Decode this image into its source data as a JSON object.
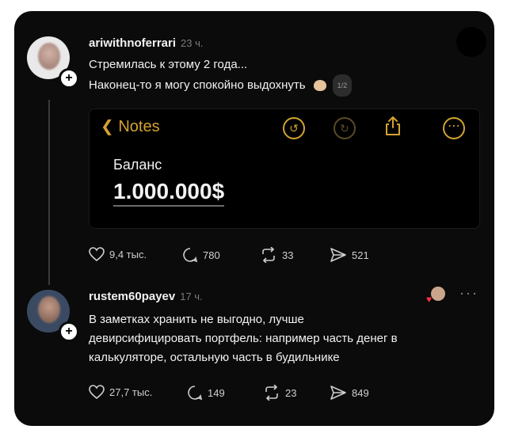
{
  "post": {
    "username": "ariwithnoferrari",
    "time": "23 ч.",
    "line1": "Стремилась к этому 2 года...",
    "line2": "Наконец-то я могу спокойно выдохнуть",
    "media_counter": "1/2",
    "notes": {
      "back_label": "Notes",
      "label": "Баланс",
      "amount": "1.000.000$"
    },
    "likes": "9,4 тыс.",
    "comments": "780",
    "reposts": "33",
    "shares": "521"
  },
  "reply": {
    "username": "rustem60payev",
    "time": "17 ч.",
    "line1": "В заметках хранить не выгодно, лучше",
    "line2": "девирсифицировать портфель: например часть денег в",
    "line3": "калькуляторе, остальную часть в будильнике",
    "likes": "27,7 тыс.",
    "comments": "149",
    "reposts": "23",
    "shares": "849"
  },
  "colors": {
    "background": "#0b0b0b",
    "notes_accent": "#d4a232",
    "text": "#f2f2f2",
    "muted": "#7a7a7a"
  },
  "icons": [
    "heart-icon",
    "comment-icon",
    "repost-icon",
    "share-icon",
    "more-icon",
    "chevron-left-icon",
    "undo-icon",
    "redo-icon",
    "share-upload-icon"
  ]
}
